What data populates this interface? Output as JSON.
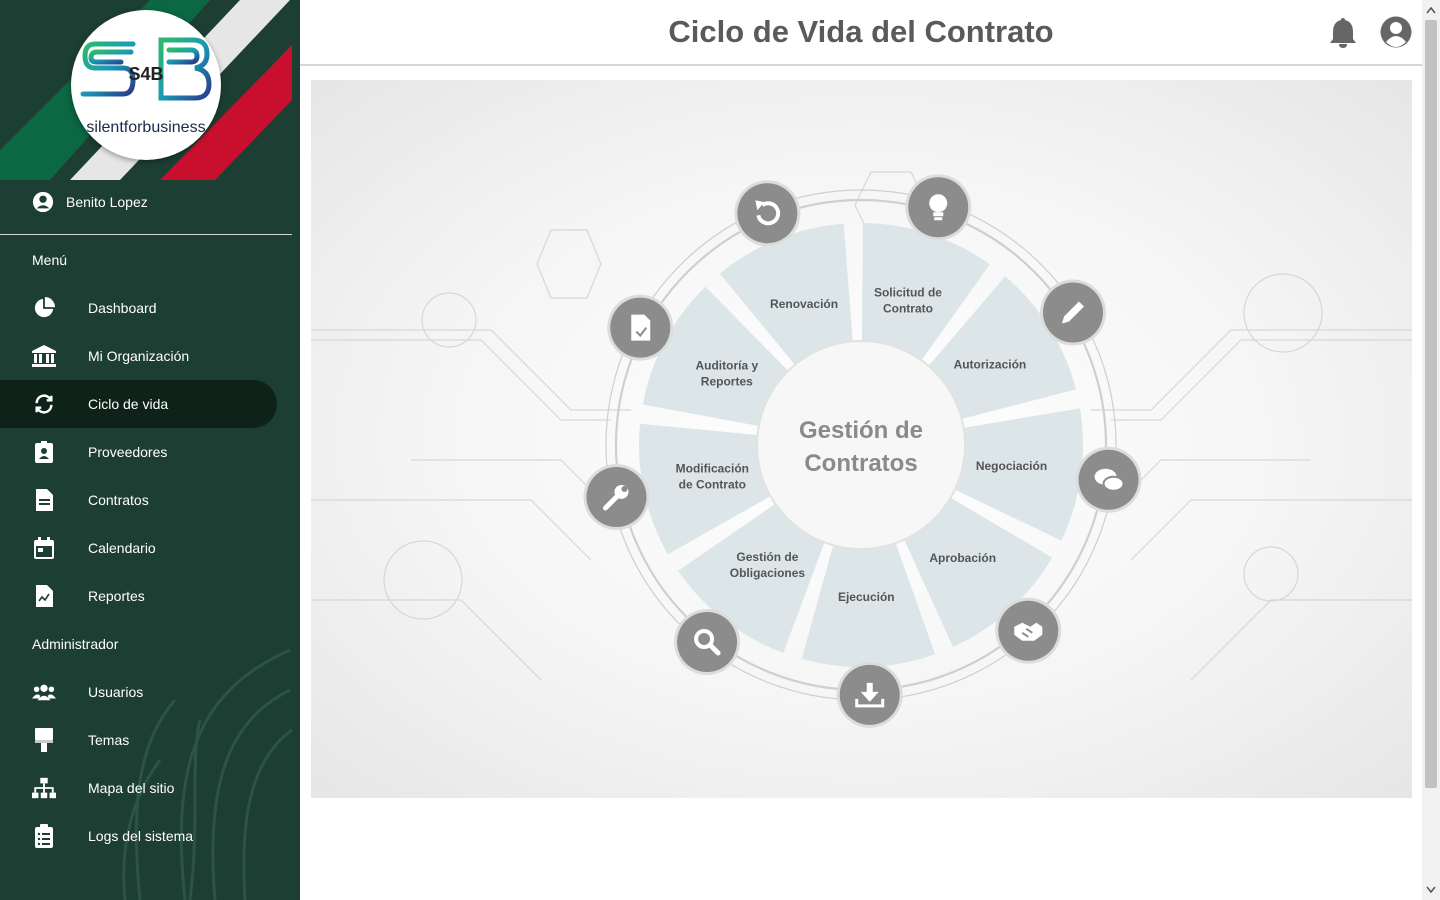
{
  "app": {
    "logo_text": "silentforbusiness",
    "logo_mark": "S4B"
  },
  "user": {
    "name": "Benito Lopez",
    "icon": "user-circle-icon"
  },
  "sidebar": {
    "menu_title": "Menú",
    "admin_title": "Administrador",
    "menu_items": [
      {
        "label": "Dashboard",
        "icon": "pie-chart-icon",
        "active": false
      },
      {
        "label": "Mi Organización",
        "icon": "building-icon",
        "active": false
      },
      {
        "label": "Ciclo de vida",
        "icon": "sync-icon",
        "active": true
      },
      {
        "label": "Proveedores",
        "icon": "id-badge-icon",
        "active": false
      },
      {
        "label": "Contratos",
        "icon": "document-icon",
        "active": false
      },
      {
        "label": "Calendario",
        "icon": "calendar-icon",
        "active": false
      },
      {
        "label": "Reportes",
        "icon": "report-icon",
        "active": false
      }
    ],
    "admin_items": [
      {
        "label": "Usuarios",
        "icon": "users-icon"
      },
      {
        "label": "Temas",
        "icon": "paint-roller-icon"
      },
      {
        "label": "Mapa del sitio",
        "icon": "sitemap-icon"
      },
      {
        "label": "Logs del sistema",
        "icon": "clipboard-list-icon"
      }
    ]
  },
  "header": {
    "title": "Ciclo de Vida del Contrato",
    "notification_icon": "bell-icon",
    "account_icon": "account-circle-icon"
  },
  "diagram": {
    "center_line1": "Gestión de",
    "center_line2": "Contratos",
    "segments": [
      {
        "label_lines": [
          "Solicitud de",
          "Contrato"
        ],
        "icon": "lightbulb-icon"
      },
      {
        "label_lines": [
          "Autorización"
        ],
        "icon": "pencil-icon"
      },
      {
        "label_lines": [
          "Negociación"
        ],
        "icon": "chat-bubbles-icon"
      },
      {
        "label_lines": [
          "Aprobación"
        ],
        "icon": "handshake-icon"
      },
      {
        "label_lines": [
          "Ejecución"
        ],
        "icon": "download-icon"
      },
      {
        "label_lines": [
          "Gestión de",
          "Obligaciones"
        ],
        "icon": "magnifier-icon"
      },
      {
        "label_lines": [
          "Modificación",
          "de Contrato"
        ],
        "icon": "wrench-icon"
      },
      {
        "label_lines": [
          "Auditoría y",
          "Reportes"
        ],
        "icon": "document-check-icon"
      },
      {
        "label_lines": [
          "Renovación"
        ],
        "icon": "refresh-icon"
      }
    ],
    "colors": {
      "segment_fill": "#dce6e8",
      "icon_circle": "#8c8c8c",
      "sidebar_bg": "#1d3e33",
      "accent_red": "#c8102e",
      "accent_green": "#006847"
    }
  }
}
